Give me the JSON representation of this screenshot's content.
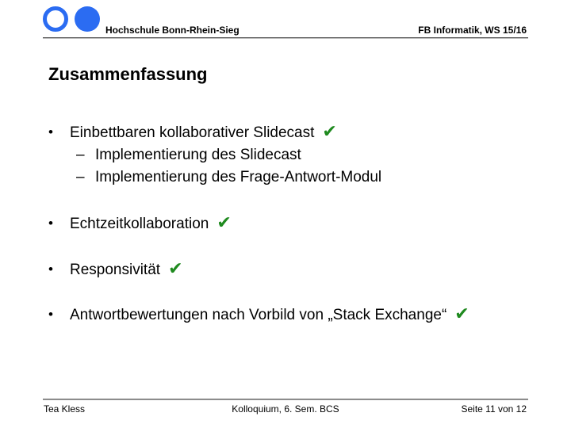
{
  "header": {
    "institution": "Hochschule Bonn-Rhein-Sieg",
    "department": "FB Informatik, WS 15/16",
    "logo_icon": "h-brs-logo-icon",
    "logo_color": "#2b6cf2"
  },
  "title": "Zusammenfassung",
  "bullets": [
    {
      "marker": "•",
      "text": "Einbettbaren kollaborativer Slidecast",
      "check": "✔",
      "subitems": [
        {
          "marker": "–",
          "text": "Implementierung des Slidecast"
        },
        {
          "marker": "–",
          "text": "Implementierung des Frage-Antwort-Modul"
        }
      ]
    },
    {
      "marker": "•",
      "text": "Echtzeitkollaboration",
      "check": "✔"
    },
    {
      "marker": "•",
      "text": "Responsivität",
      "check": "✔"
    },
    {
      "marker": "•",
      "text": "Antwortbewertungen nach Vorbild von „Stack Exchange“",
      "check": "✔"
    }
  ],
  "check_color": "#1f8a1f",
  "footer": {
    "author": "Tea Kless",
    "event": "Kolloquium, 6. Sem. BCS",
    "page": "Seite 11 von 12"
  }
}
